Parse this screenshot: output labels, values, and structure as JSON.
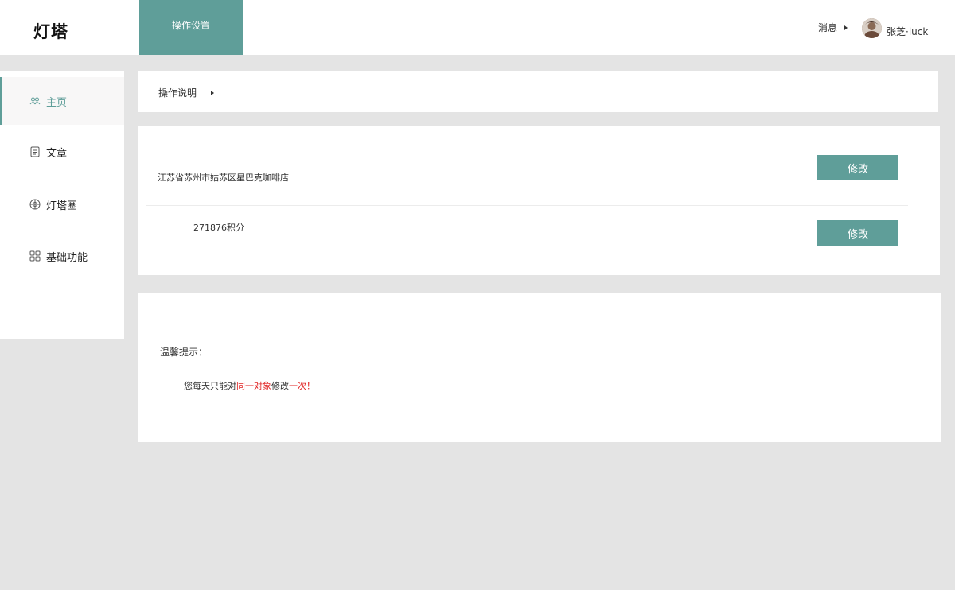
{
  "header": {
    "logo": "灯塔",
    "active_tab": "操作设置",
    "messages_label": "消息",
    "username": "张芝·luck"
  },
  "sidebar": {
    "items": [
      {
        "label": "主页",
        "icon": "people-icon",
        "active": true
      },
      {
        "label": "文章",
        "icon": "document-icon",
        "active": false
      },
      {
        "label": "灯塔圈",
        "icon": "circle-grid-icon",
        "active": false
      },
      {
        "label": "基础功能",
        "icon": "apps-grid-icon",
        "active": false
      }
    ]
  },
  "instructions": {
    "label": "操作说明"
  },
  "info": {
    "address": "江苏省苏州市姑苏区星巴克咖啡店",
    "points": "271876积分",
    "edit_label": "修改"
  },
  "tips": {
    "title": "温馨提示：",
    "part1": "您每天只能对",
    "part2": "同一对象",
    "part3": "修改",
    "part4": "一次！"
  },
  "colors": {
    "accent": "#5f9e99",
    "highlight": "#e02020",
    "background": "#e4e4e4"
  }
}
